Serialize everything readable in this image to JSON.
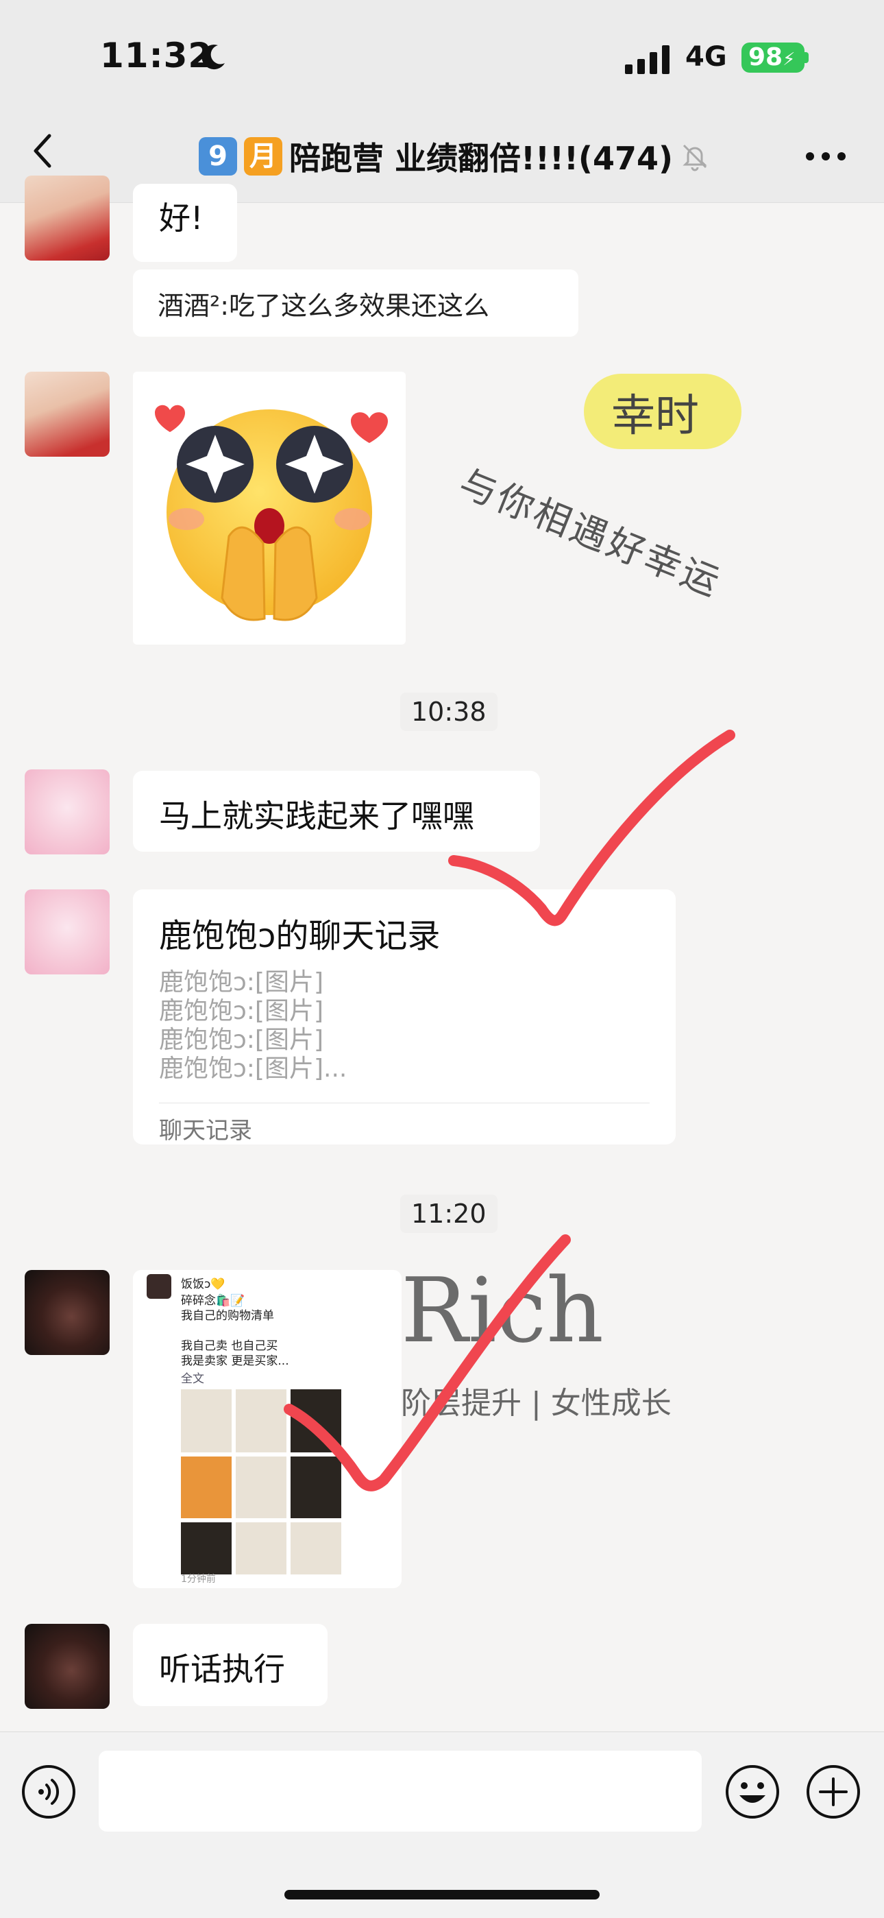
{
  "status_bar": {
    "time": "11:32",
    "network": "4G",
    "battery": "98"
  },
  "header": {
    "emoji_1": "9",
    "emoji_2": "月",
    "title": "陪跑营 业绩翻倍!!!!(474)"
  },
  "messages": {
    "m1_text": "好!",
    "m1_quote": "酒酒²:吃了这么多效果还这么",
    "bg_badge": "幸时",
    "bg_curve": "与你相遇好幸运",
    "time_1": "10:38",
    "m3_text": "马上就实践起来了嘿嘿",
    "record_title": "鹿饱饱ↄ的聊天记录",
    "record_lines": [
      "鹿饱饱ↄ:[图片]",
      "鹿饱饱ↄ:[图片]",
      "鹿饱饱ↄ:[图片]",
      "鹿饱饱ↄ:[图片]..."
    ],
    "record_footer": "聊天记录",
    "time_2": "11:20",
    "bg_rich": "Rich",
    "bg_tagline": "阶层提升 | 女性成长",
    "post_user": "饭饭ↄ💛",
    "post_line1": "碎碎念🛍️📝",
    "post_line2": "我自己的购物清单",
    "post_line3": "我自己卖 也自己买",
    "post_line4": "我是卖家 更是买家...",
    "post_more": "全文",
    "post_time": "1分钟前",
    "m6_text": "听话执行"
  },
  "colors": {
    "check_mark": "#f0464f",
    "badge_yellow": "#f3ec78",
    "battery_green": "#35c759"
  }
}
